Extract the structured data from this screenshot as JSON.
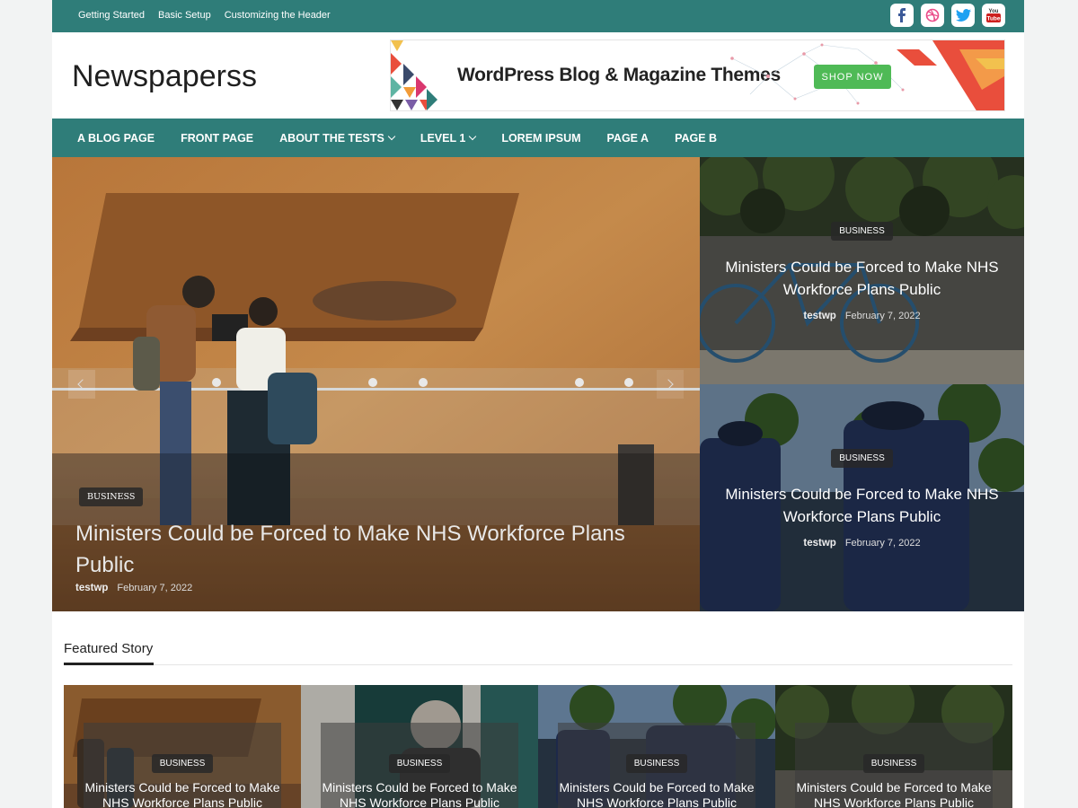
{
  "topbar": {
    "links": [
      "Getting Started",
      "Basic Setup",
      "Customizing the Header"
    ],
    "social_icons": [
      "facebook-icon",
      "dribbble-icon",
      "twitter-icon",
      "youtube-icon"
    ],
    "youtube_text": "You Tube"
  },
  "header": {
    "site_title": "Newspaperss",
    "ad": {
      "headline": "WordPress Blog & Magazine Themes",
      "button": "SHOP NOW"
    }
  },
  "nav": {
    "items": [
      {
        "label": "A BLOG PAGE"
      },
      {
        "label": "FRONT PAGE"
      },
      {
        "label": "ABOUT THE TESTS"
      },
      {
        "label": "LEVEL 1"
      },
      {
        "label": "LOREM IPSUM"
      },
      {
        "label": "PAGE A"
      },
      {
        "label": "PAGE B"
      }
    ]
  },
  "hero": {
    "main": {
      "category": "BUSINESS",
      "title": "Ministers Could be Forced to Make NHS Workforce Plans Public",
      "author": "testwp",
      "date": "February 7, 2022"
    },
    "side": [
      {
        "category": "BUSINESS",
        "title": "Ministers Could be Forced to Make NHS Workforce Plans Public",
        "author": "testwp",
        "date": "February 7, 2022"
      },
      {
        "category": "BUSINESS",
        "title": "Ministers Could be Forced to Make NHS Workforce Plans Public",
        "author": "testwp",
        "date": "February 7, 2022"
      }
    ]
  },
  "featured": {
    "heading": "Featured Story",
    "cards": [
      {
        "category": "BUSINESS",
        "title": "Ministers Could be Forced to Make NHS Workforce Plans Public"
      },
      {
        "category": "BUSINESS",
        "title": "Ministers Could be Forced to Make NHS Workforce Plans Public"
      },
      {
        "category": "BUSINESS",
        "title": "Ministers Could be Forced to Make NHS Workforce Plans Public"
      },
      {
        "category": "BUSINESS",
        "title": "Ministers Could be Forced to Make NHS Workforce Plans Public"
      }
    ]
  },
  "colors": {
    "brand": "#2f7d79",
    "ad_button": "#4fba56"
  }
}
